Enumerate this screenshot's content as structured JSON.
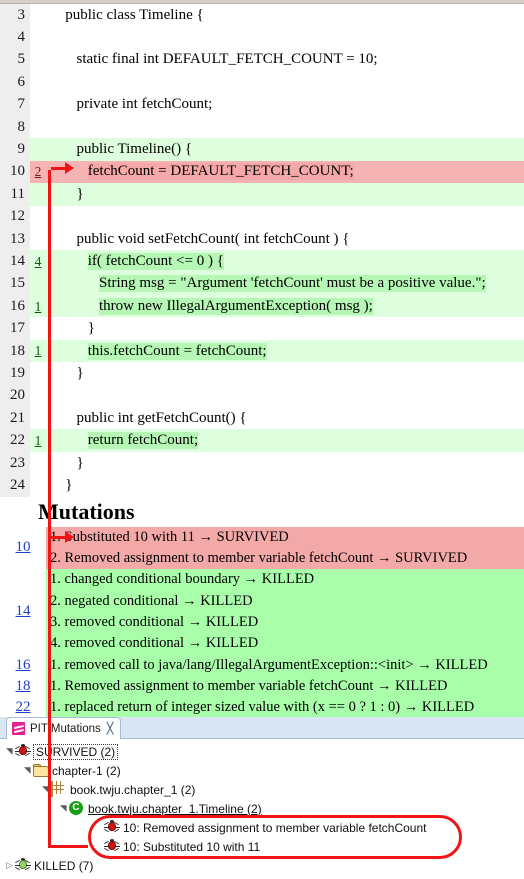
{
  "editor": {
    "lines": [
      {
        "num": "3",
        "count": "",
        "text": "public class Timeline {",
        "indent": 1,
        "state": "none"
      },
      {
        "num": "4",
        "count": "",
        "text": "",
        "indent": 0,
        "state": "none"
      },
      {
        "num": "5",
        "count": "",
        "text": "static final int DEFAULT_FETCH_COUNT = 10;",
        "indent": 2,
        "state": "none"
      },
      {
        "num": "6",
        "count": "",
        "text": "",
        "indent": 0,
        "state": "none"
      },
      {
        "num": "7",
        "count": "",
        "text": "private int fetchCount;",
        "indent": 2,
        "state": "none"
      },
      {
        "num": "8",
        "count": "",
        "text": "",
        "indent": 0,
        "state": "none"
      },
      {
        "num": "9",
        "count": "",
        "text": "public Timeline() {",
        "indent": 2,
        "state": "covered"
      },
      {
        "num": "10",
        "count": "2",
        "text": "fetchCount = DEFAULT_FETCH_COUNT;",
        "indent": 3,
        "state": "survived"
      },
      {
        "num": "11",
        "count": "",
        "text": "}",
        "indent": 2,
        "state": "covered"
      },
      {
        "num": "12",
        "count": "",
        "text": "",
        "indent": 0,
        "state": "none"
      },
      {
        "num": "13",
        "count": "",
        "text": "public void setFetchCount( int fetchCount ) {",
        "indent": 2,
        "state": "none"
      },
      {
        "num": "14",
        "count": "4",
        "text": "if( fetchCount <= 0 ) {",
        "indent": 3,
        "state": "killed"
      },
      {
        "num": "15",
        "count": "",
        "text": "String msg = \"Argument 'fetchCount' must be a positive value.\";",
        "indent": 4,
        "state": "killed"
      },
      {
        "num": "16",
        "count": "1",
        "text": "throw new IllegalArgumentException( msg );",
        "indent": 4,
        "state": "killed"
      },
      {
        "num": "17",
        "count": "",
        "text": "}",
        "indent": 3,
        "state": "none"
      },
      {
        "num": "18",
        "count": "1",
        "text": "this.fetchCount = fetchCount;",
        "indent": 3,
        "state": "killed"
      },
      {
        "num": "19",
        "count": "",
        "text": "}",
        "indent": 2,
        "state": "none"
      },
      {
        "num": "20",
        "count": "",
        "text": "",
        "indent": 0,
        "state": "none"
      },
      {
        "num": "21",
        "count": "",
        "text": "public int getFetchCount() {",
        "indent": 2,
        "state": "none"
      },
      {
        "num": "22",
        "count": "1",
        "text": "return fetchCount;",
        "indent": 3,
        "state": "killed"
      },
      {
        "num": "23",
        "count": "",
        "text": "}",
        "indent": 2,
        "state": "none"
      },
      {
        "num": "24",
        "count": "",
        "text": "}",
        "indent": 1,
        "state": "none"
      }
    ]
  },
  "mutations": {
    "heading": "Mutations",
    "blocks": [
      {
        "line": "10",
        "status": "survived",
        "items": [
          "1. Substituted 10 with 11 → SURVIVED",
          "2. Removed assignment to member variable fetchCount → SURVIVED"
        ]
      },
      {
        "line": "14",
        "status": "killed",
        "items": [
          "1. changed conditional boundary → KILLED",
          "2. negated conditional → KILLED",
          "3. removed conditional → KILLED",
          "4. removed conditional → KILLED"
        ]
      },
      {
        "line": "16",
        "status": "killed",
        "items": [
          "1. removed call to java/lang/IllegalArgumentException::<init> → KILLED"
        ]
      },
      {
        "line": "18",
        "status": "killed",
        "items": [
          "1. Removed assignment to member variable fetchCount → KILLED"
        ]
      },
      {
        "line": "22",
        "status": "killed",
        "items": [
          "1. replaced return of integer sized value with (x == 0 ? 1 : 0) → KILLED"
        ]
      }
    ]
  },
  "view": {
    "tab": {
      "label": "PIT Mutations",
      "close_glyph": "╳",
      "icon": "pit-mutations-icon"
    },
    "tree": [
      {
        "label": "SURVIVED (2)",
        "icon": "bug-red-icon",
        "twisty": "open",
        "indent": 0,
        "selected": true,
        "link": false
      },
      {
        "label": "chapter-1 (2)",
        "icon": "folder-icon",
        "twisty": "open",
        "indent": 1,
        "selected": false,
        "link": false
      },
      {
        "label": "book.twju.chapter_1 (2)",
        "icon": "package-icon",
        "twisty": "open",
        "indent": 2,
        "selected": false,
        "link": false
      },
      {
        "label": "book.twju.chapter_1.Timeline (2)",
        "icon": "class-icon",
        "twisty": "open",
        "indent": 3,
        "selected": false,
        "link": true
      },
      {
        "label": "10: Removed assignment to member variable fetchCount",
        "icon": "bug-red-icon",
        "twisty": "none",
        "indent": 4,
        "selected": false,
        "link": false
      },
      {
        "label": "10: Substituted 10 with 11",
        "icon": "bug-red-icon",
        "twisty": "none",
        "indent": 4,
        "selected": false,
        "link": false
      },
      {
        "label": "KILLED (7)",
        "icon": "bug-green-icon",
        "twisty": "closed",
        "indent": 0,
        "selected": false,
        "link": false
      }
    ],
    "class_icon_glyph": "C"
  },
  "colors": {
    "survived_bg": "#f4a9a9",
    "killed_bg": "#a9ffa9",
    "covered_bg": "#ddffdd",
    "annotation": "#f21414",
    "tab_icon": "#e8218c",
    "link": "#1f3fd0"
  }
}
